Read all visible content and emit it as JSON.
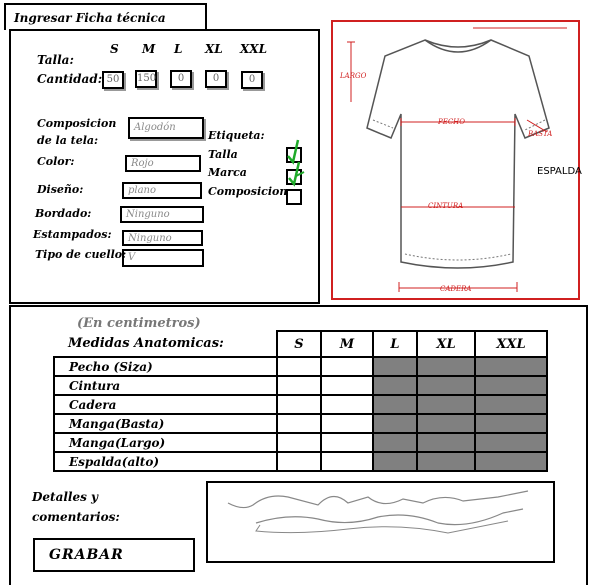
{
  "title": "Ingresar Ficha técnica",
  "sizes_header": [
    "S",
    "M",
    "L",
    "XL",
    "XXL"
  ],
  "form": {
    "talla_label": "Talla:",
    "cantidad_label": "Cantidad:",
    "cantidades": [
      "50",
      "150",
      "0",
      "0",
      "0"
    ],
    "composicion_label": "Composicion de la tela:",
    "composicion_value": "Algodón",
    "color_label": "Color:",
    "color_value": "Rojo",
    "diseno_label": "Diseño:",
    "diseno_value": "plano",
    "bordado_label": "Bordado:",
    "bordado_value": "Ninguno",
    "estampados_label": "Estampados:",
    "estampados_value": "Ninguno",
    "cuello_label": "Tipo de cuello:",
    "cuello_value": "V"
  },
  "etiqueta": {
    "title": "Etiqueta:",
    "options": [
      {
        "label": "Talla",
        "checked": true
      },
      {
        "label": "Marca",
        "checked": true
      },
      {
        "label": "Composicion",
        "checked": false
      }
    ]
  },
  "diagram": {
    "largo": "LARGO",
    "pecho": "PECHO",
    "basta": "BASTA",
    "espalda": "ESPALDA",
    "cintura": "CINTURA",
    "cadera": "CADERA"
  },
  "medidas": {
    "note": "(En centimetros)",
    "header": "Medidas Anatomicas:",
    "columns": [
      "S",
      "M",
      "L",
      "XL",
      "XXL"
    ],
    "rows": [
      "Pecho (Siza)",
      "Cintura",
      "Cadera",
      "Manga(Basta)",
      "Manga(Largo)",
      "Espalda(alto)"
    ]
  },
  "comentarios_label_1": "Detalles y",
  "comentarios_label_2": "comentarios:",
  "save_label": "GRABAR",
  "colors": {
    "accent_red": "#d02020",
    "check_green": "#1faa2a",
    "grey_cell": "#808080"
  }
}
